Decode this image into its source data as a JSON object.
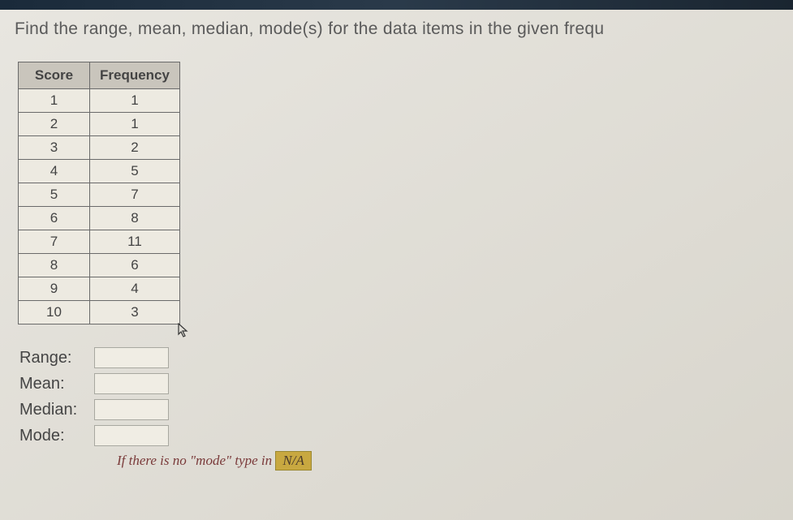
{
  "prompt": "Find the range, mean, median, mode(s) for the data items in the given frequ",
  "table": {
    "headers": [
      "Score",
      "Frequency"
    ],
    "rows": [
      {
        "score": "1",
        "freq": "1"
      },
      {
        "score": "2",
        "freq": "1"
      },
      {
        "score": "3",
        "freq": "2"
      },
      {
        "score": "4",
        "freq": "5"
      },
      {
        "score": "5",
        "freq": "7"
      },
      {
        "score": "6",
        "freq": "8"
      },
      {
        "score": "7",
        "freq": "11"
      },
      {
        "score": "8",
        "freq": "6"
      },
      {
        "score": "9",
        "freq": "4"
      },
      {
        "score": "10",
        "freq": "3"
      }
    ]
  },
  "answers": {
    "range_label": "Range:",
    "mean_label": "Mean:",
    "median_label": "Median:",
    "mode_label": "Mode:",
    "range_value": "",
    "mean_value": "",
    "median_value": "",
    "mode_value": ""
  },
  "hint_prefix": "If there is no \"mode\" type in",
  "hint_na": "N/A",
  "chart_data": {
    "type": "table",
    "title": "Frequency Distribution",
    "columns": [
      "Score",
      "Frequency"
    ],
    "rows": [
      [
        1,
        1
      ],
      [
        2,
        1
      ],
      [
        3,
        2
      ],
      [
        4,
        5
      ],
      [
        5,
        7
      ],
      [
        6,
        8
      ],
      [
        7,
        11
      ],
      [
        8,
        6
      ],
      [
        9,
        4
      ],
      [
        10,
        3
      ]
    ]
  }
}
